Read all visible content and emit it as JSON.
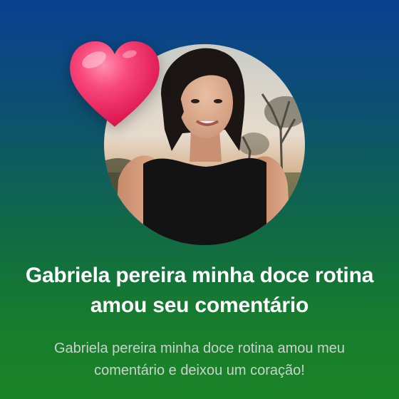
{
  "notification": {
    "title": "Gabriela pereira minha doce rotina amou seu comentário",
    "message": "Gabriela pereira minha doce rotina amou meu comentário e deixou um coração!",
    "reaction_icon": "heart-icon",
    "colors": {
      "heart": "#f0386b",
      "title_text": "#ffffff",
      "message_text": "#c9d3cc",
      "gradient_top": "#0b3f92",
      "gradient_bottom": "#1b8327"
    }
  }
}
